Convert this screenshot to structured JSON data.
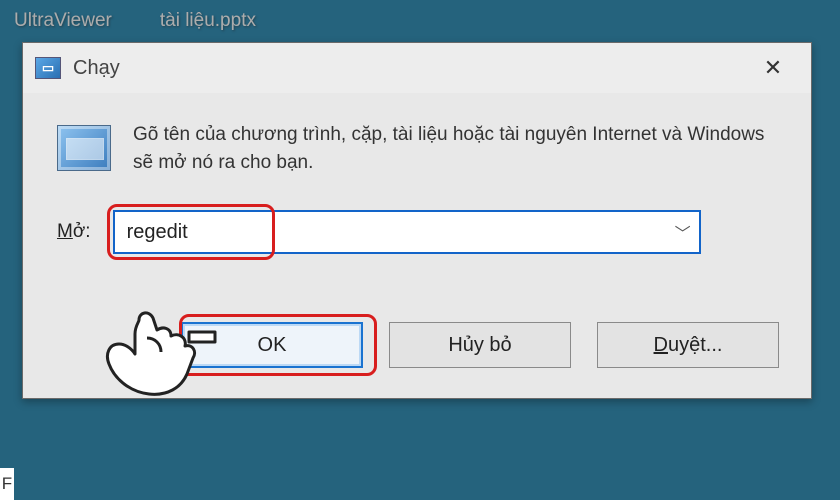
{
  "desktop": {
    "icons": [
      "UltraViewer",
      "tài liệu.pptx"
    ]
  },
  "dialog": {
    "title": "Chạy",
    "description": "Gõ tên của chương trình, cặp, tài liệu hoặc tài nguyên Internet và Windows sẽ mở nó ra cho bạn.",
    "open_label_prefix": "M",
    "open_label_rest": "ở:",
    "input_value": "regedit",
    "buttons": {
      "ok": "OK",
      "cancel": "Hủy bỏ",
      "browse_prefix": "D",
      "browse_rest": "uyệt..."
    }
  },
  "footer_char": "F"
}
